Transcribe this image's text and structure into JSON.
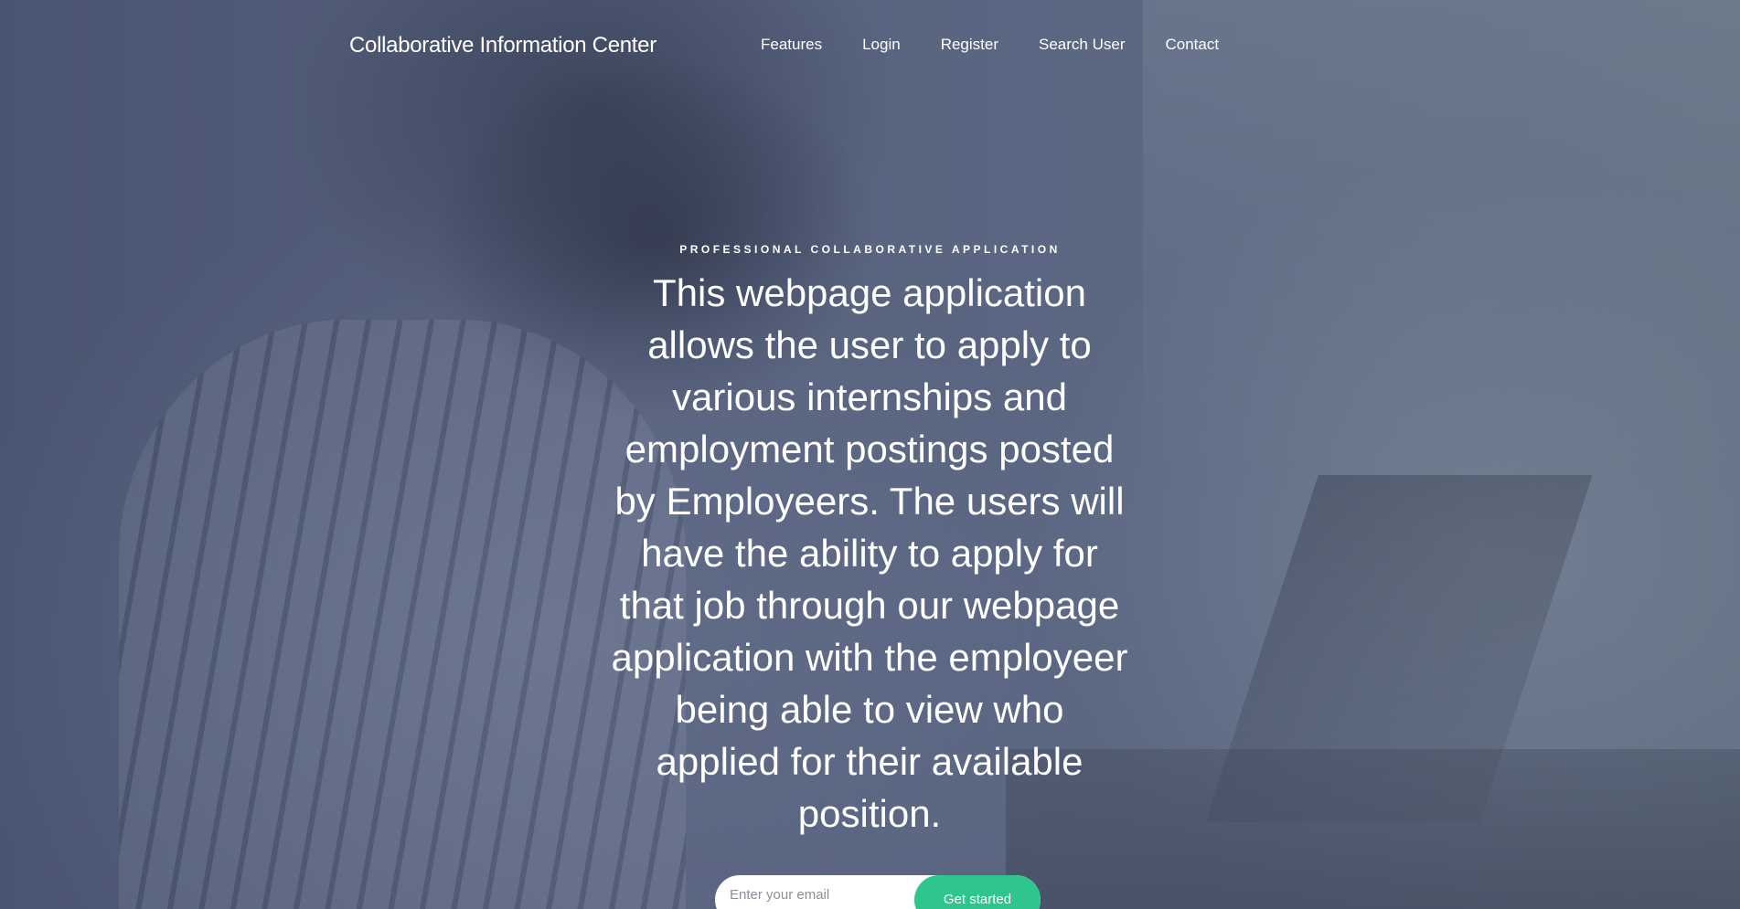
{
  "header": {
    "brand": "Collaborative Information Center",
    "nav": [
      {
        "label": "Features"
      },
      {
        "label": "Login"
      },
      {
        "label": "Register"
      },
      {
        "label": "Search User"
      },
      {
        "label": "Contact"
      }
    ]
  },
  "hero": {
    "kicker": "PROFESSIONAL COLLABORATIVE APPLICATION",
    "headline": "This webpage application allows the user to apply to various internships and employment postings posted by Employeers. The users will have the ability to apply for that job through our webpage application with the employeer being able to view who applied for their available position."
  },
  "signup": {
    "email_placeholder": "Enter your email",
    "button_label": "Get started"
  },
  "colors": {
    "overlay": "#56607c",
    "accent": "#2ec68c",
    "text": "#ffffff"
  }
}
